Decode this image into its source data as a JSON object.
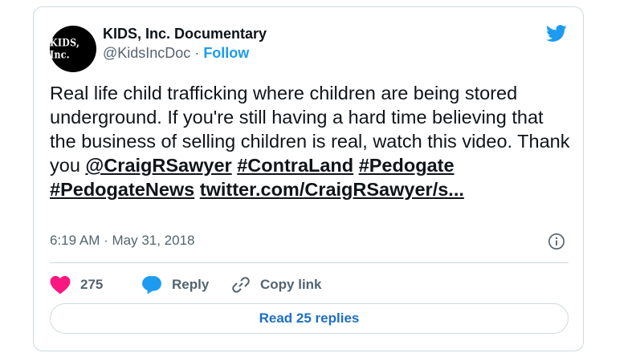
{
  "author": {
    "avatar_text": "KIDS, Inc.",
    "display_name": "KIDS, Inc. Documentary",
    "handle": "@KidsIncDoc",
    "separator": " · ",
    "follow_label": "Follow"
  },
  "tweet": {
    "text_plain": "Real life child trafficking where children are being stored underground. If you're still having a hard time believing that the business of selling children is real, watch this video. Thank you ",
    "mention": "@CraigRSawyer",
    "hashtag_1": "#ContraLand",
    "hashtag_2": "#Pedogate",
    "hashtag_3": "#PedogateNews",
    "url": "twitter.com/CraigRSawyer/s..."
  },
  "meta": {
    "timestamp": "6:19 AM · May 31, 2018"
  },
  "actions": {
    "like_count": "275",
    "reply_label": "Reply",
    "copy_link_label": "Copy link"
  },
  "footer": {
    "read_replies_label": "Read 25 replies"
  },
  "icons": {
    "brand": "twitter-bird-icon",
    "info": "info-icon",
    "like": "heart-icon",
    "reply": "speech-bubble-icon",
    "copy_link": "chain-link-icon"
  },
  "colors": {
    "twitter_blue": "#1d9bf0",
    "like_pink": "#f91880",
    "text_primary": "#0f1419",
    "text_secondary": "#536471",
    "border": "#cfd9de"
  }
}
